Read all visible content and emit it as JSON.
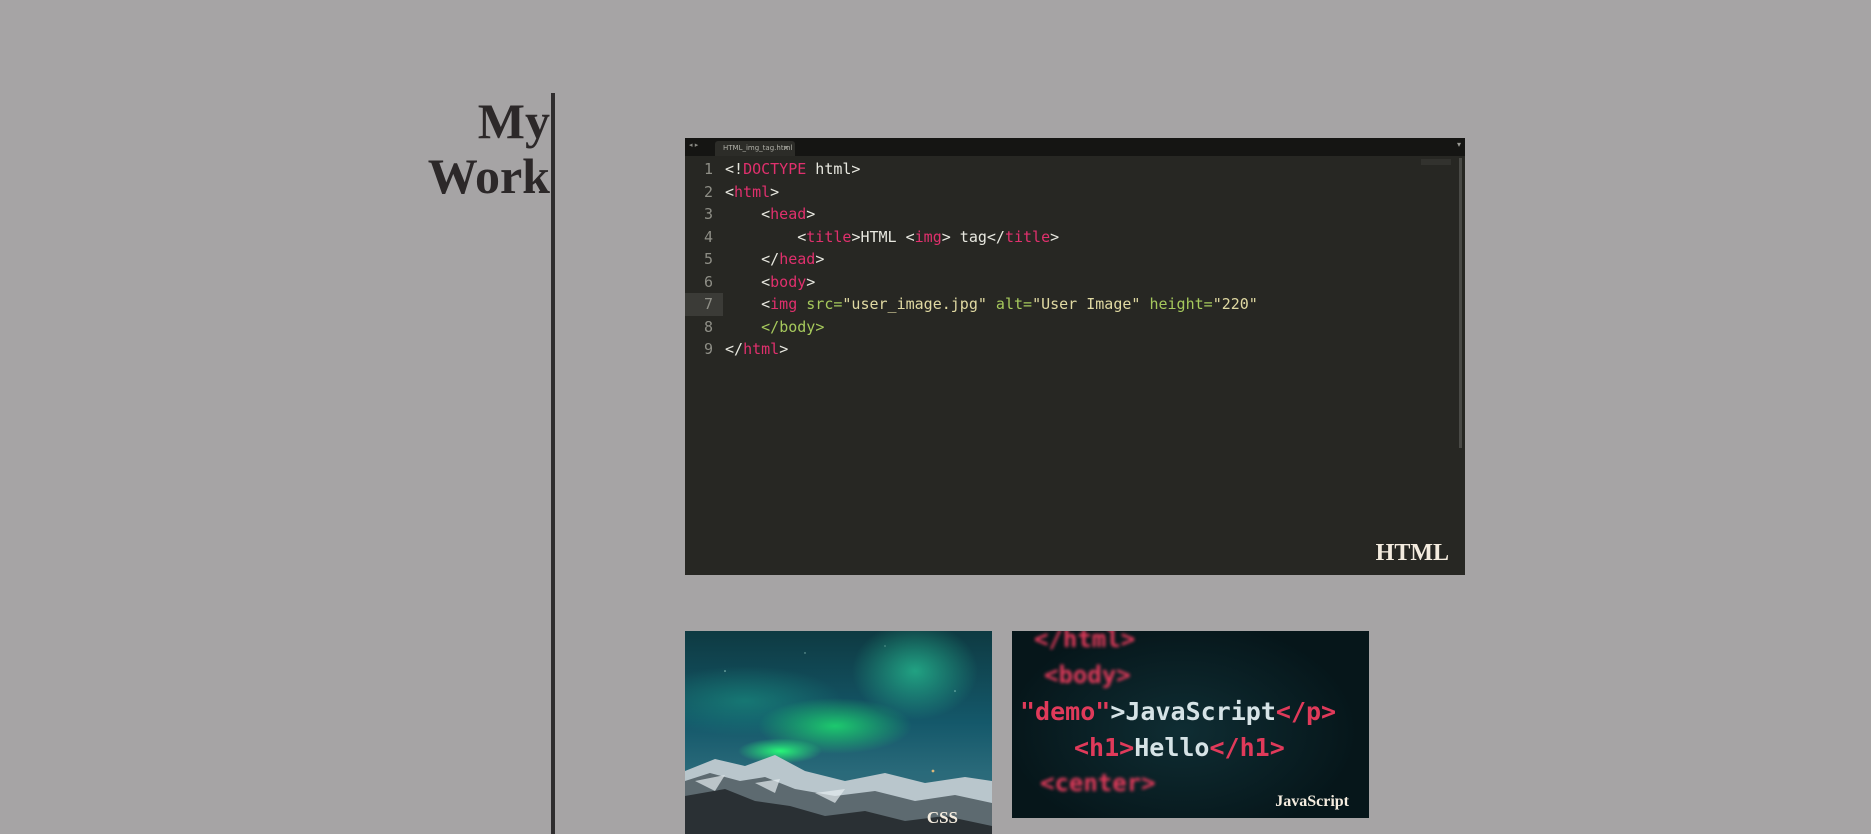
{
  "heading": {
    "line1": "My",
    "line2": "Work"
  },
  "tiles": {
    "html": {
      "caption": "HTML",
      "editor": {
        "tab_label": "HTML_img_tag.html",
        "tab_close": "×",
        "tab_arrows": "◂ ▸",
        "window_button": "▾",
        "active_line": 7,
        "lines": [
          {
            "num": "1",
            "parts": [
              {
                "t": "<!",
                "c": "plain"
              },
              {
                "t": "DOCTYPE",
                "c": "tag"
              },
              {
                "t": " html>",
                "c": "plain"
              }
            ]
          },
          {
            "num": "2",
            "parts": [
              {
                "t": "<",
                "c": "plain"
              },
              {
                "t": "html",
                "c": "tag"
              },
              {
                "t": ">",
                "c": "plain"
              }
            ]
          },
          {
            "num": "3",
            "parts": [
              {
                "t": "    <",
                "c": "plain"
              },
              {
                "t": "head",
                "c": "tag"
              },
              {
                "t": ">",
                "c": "plain"
              }
            ]
          },
          {
            "num": "4",
            "parts": [
              {
                "t": "        <",
                "c": "plain"
              },
              {
                "t": "title",
                "c": "tag"
              },
              {
                "t": ">HTML <",
                "c": "plain"
              },
              {
                "t": "img",
                "c": "tag"
              },
              {
                "t": "> tag</",
                "c": "plain"
              },
              {
                "t": "title",
                "c": "tag"
              },
              {
                "t": ">",
                "c": "plain"
              }
            ]
          },
          {
            "num": "5",
            "parts": [
              {
                "t": "    </",
                "c": "plain"
              },
              {
                "t": "head",
                "c": "tag"
              },
              {
                "t": ">",
                "c": "plain"
              }
            ]
          },
          {
            "num": "6",
            "parts": [
              {
                "t": "    <",
                "c": "plain"
              },
              {
                "t": "body",
                "c": "tag"
              },
              {
                "t": ">",
                "c": "plain"
              }
            ]
          },
          {
            "num": "7",
            "parts": [
              {
                "t": "    <",
                "c": "plain"
              },
              {
                "t": "img",
                "c": "tag"
              },
              {
                "t": " src=",
                "c": "attr"
              },
              {
                "t": "\"user_image.jpg\"",
                "c": "str"
              },
              {
                "t": " alt=",
                "c": "attr"
              },
              {
                "t": "\"User Image\"",
                "c": "str"
              },
              {
                "t": " height=",
                "c": "attr"
              },
              {
                "t": "\"220\"",
                "c": "str"
              }
            ]
          },
          {
            "num": "8",
            "parts": [
              {
                "t": "    </",
                "c": "attr"
              },
              {
                "t": "body",
                "c": "attr"
              },
              {
                "t": ">",
                "c": "attr"
              }
            ]
          },
          {
            "num": "9",
            "parts": [
              {
                "t": "</",
                "c": "plain"
              },
              {
                "t": "html",
                "c": "tag"
              },
              {
                "t": ">",
                "c": "plain"
              }
            ]
          }
        ]
      }
    },
    "css": {
      "caption": "CSS"
    },
    "javascript": {
      "caption": "JavaScript",
      "lines": [
        {
          "parts": [
            {
              "t": "</html>",
              "c": "tag"
            }
          ],
          "blur": true
        },
        {
          "parts": [
            {
              "t": "<body>",
              "c": "tag"
            }
          ],
          "blur": true
        },
        {
          "parts": [
            {
              "t": "\"demo\"",
              "c": "tag"
            },
            {
              "t": ">JavaScript",
              "c": "str"
            },
            {
              "t": "</p>",
              "c": "tag"
            }
          ],
          "blur": false
        },
        {
          "parts": [
            {
              "t": "<h1>",
              "c": "tag"
            },
            {
              "t": "Hello",
              "c": "str"
            },
            {
              "t": "</h1>",
              "c": "tag"
            }
          ],
          "blur": false
        },
        {
          "parts": [
            {
              "t": "<center>",
              "c": "tag"
            }
          ],
          "blur": true
        }
      ]
    }
  },
  "colors": {
    "background": "#a6a4a5",
    "heading": "#2c2829",
    "caption": "#f4ecdf",
    "editor_bg": "#272723",
    "code_tag": "#e0306d",
    "code_attr": "#a6c95c",
    "code_string": "#e0d9a2"
  }
}
